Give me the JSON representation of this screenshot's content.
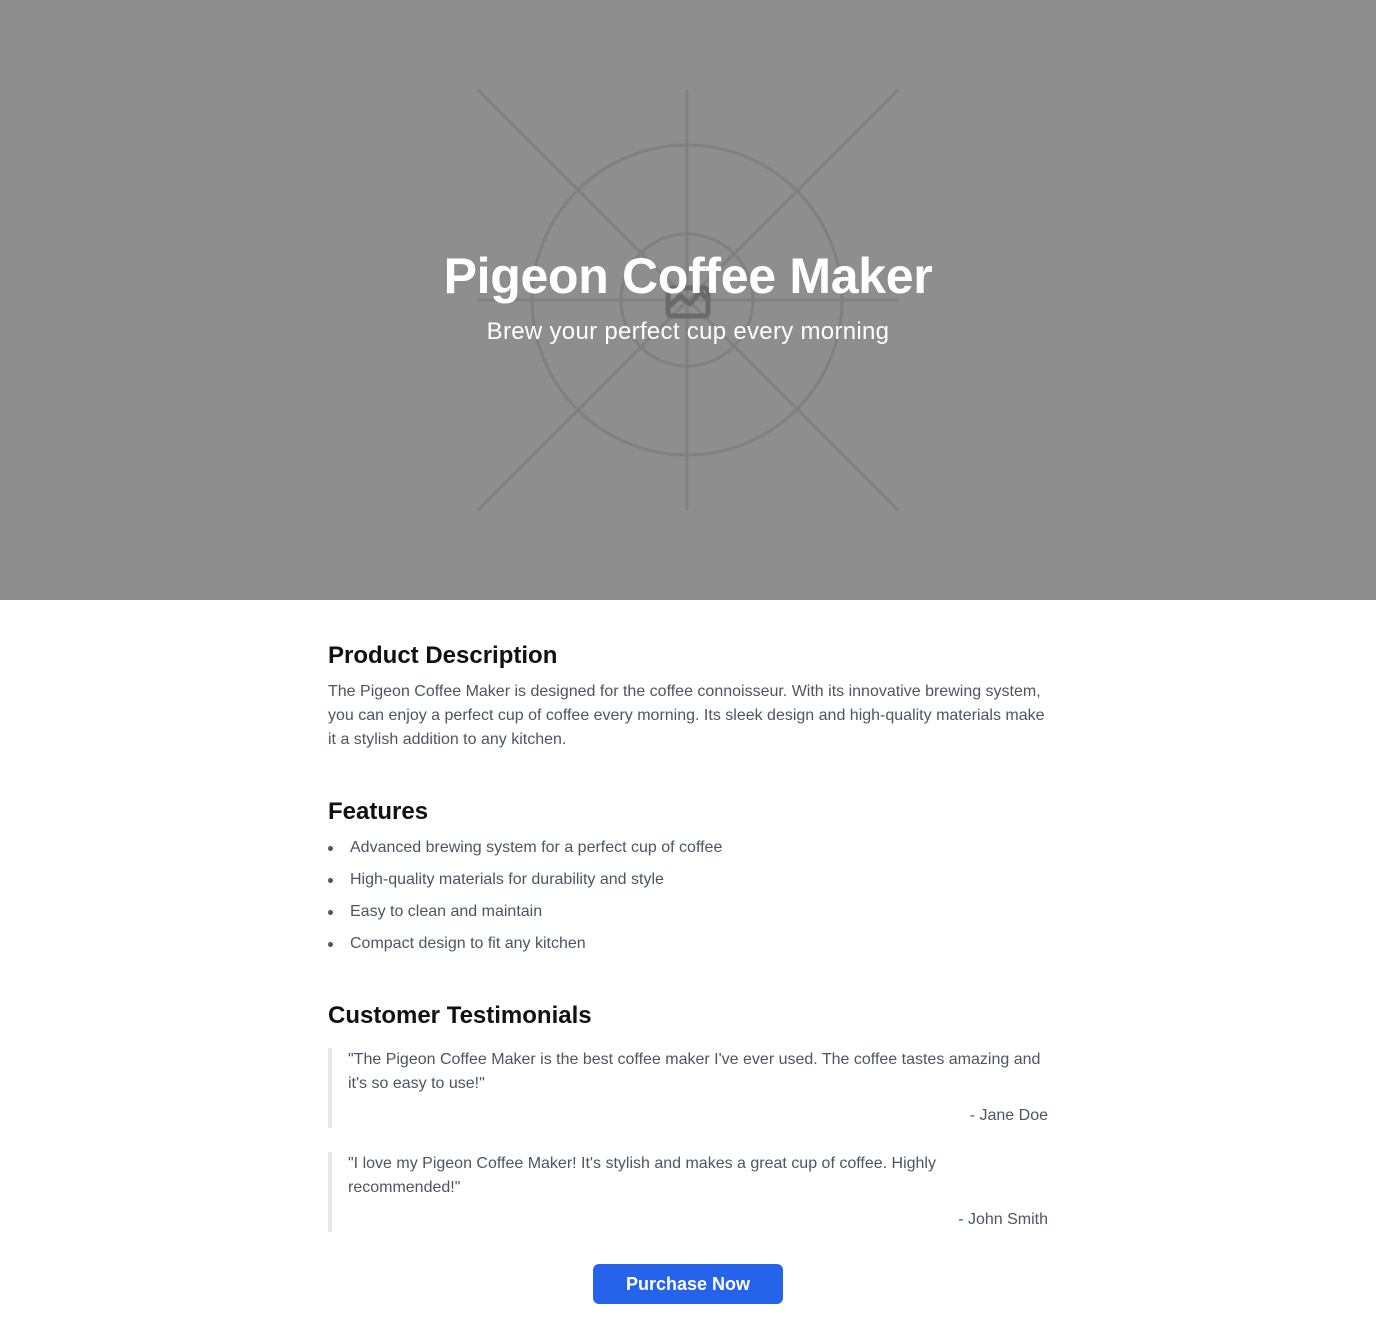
{
  "hero": {
    "title": "Pigeon Coffee Maker",
    "subtitle": "Brew your perfect cup every morning",
    "background_color": "#8e8e8e",
    "image_placeholder_icon": "image-placeholder-icon"
  },
  "description": {
    "heading": "Product Description",
    "text": "The Pigeon Coffee Maker is designed for the coffee connoisseur. With its innovative brewing system, you can enjoy a perfect cup of coffee every morning. Its sleek design and high-quality materials make it a stylish addition to any kitchen."
  },
  "features": {
    "heading": "Features",
    "items": [
      "Advanced brewing system for a perfect cup of coffee",
      "High-quality materials for durability and style",
      "Easy to clean and maintain",
      "Compact design to fit any kitchen"
    ]
  },
  "testimonials": {
    "heading": "Customer Testimonials",
    "items": [
      {
        "quote": "\"The Pigeon Coffee Maker is the best coffee maker I've ever used. The coffee tastes amazing and it's so easy to use!\"",
        "author": "- Jane Doe"
      },
      {
        "quote": "\"I love my Pigeon Coffee Maker! It's stylish and makes a great cup of coffee. Highly recommended!\"",
        "author": "- John Smith"
      }
    ]
  },
  "cta": {
    "label": "Purchase Now",
    "color": "#2563eb"
  }
}
